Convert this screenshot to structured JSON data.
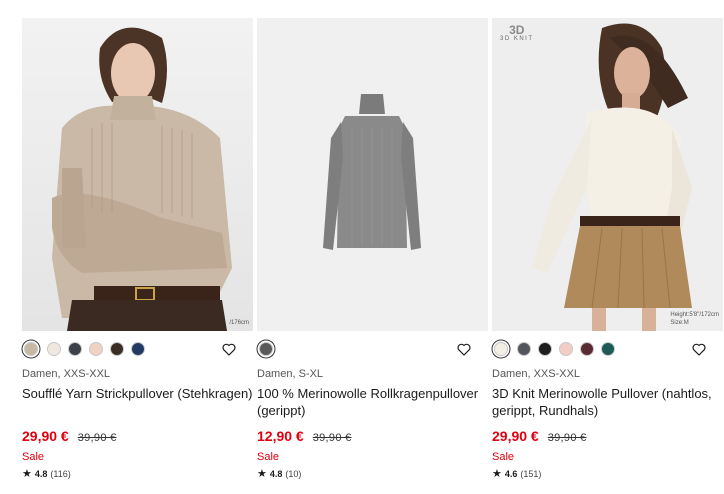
{
  "products": [
    {
      "image_alt": "Souffle Yarn sweater product image",
      "caption": "/176cm",
      "swatches": [
        "#c7b8a6",
        "#efe8e0",
        "#3c4047",
        "#f0d2c4",
        "#3a2d23",
        "#213a64"
      ],
      "selected_swatch": 0,
      "meta": "Damen, XXS-XXL",
      "name": "Soufflé Yarn Strickpullover (Stehkragen)",
      "price": "29,90 €",
      "old_price": "39,90 €",
      "sale": "Sale",
      "rating": "4.8",
      "reviews": "(116)"
    },
    {
      "image_alt": "Merino turtleneck product image",
      "caption": "",
      "swatches": [
        "#5a5a5a"
      ],
      "selected_swatch": 0,
      "meta": "Damen, S-XL",
      "name": "100 % Merinowolle Rollkragenpullover (gerippt)",
      "price": "12,90 €",
      "old_price": "39,90 €",
      "sale": "Sale",
      "rating": "4.8",
      "reviews": "(10)"
    },
    {
      "image_alt": "3D Knit merino sweater product image",
      "badge_mark": "3D",
      "badge_text": "3D KNIT",
      "caption_line1": "Height:5'8\"/172cm",
      "caption_line2": "Size:M",
      "swatches": [
        "#f4efe5",
        "#52565c",
        "#1e1e1e",
        "#f1cdc6",
        "#5a2a33",
        "#1d5a55"
      ],
      "selected_swatch": 0,
      "meta": "Damen, XXS-XXL",
      "name": "3D Knit Merinowolle Pullover (nahtlos, gerippt, Rundhals)",
      "price": "29,90 €",
      "old_price": "39,90 €",
      "sale": "Sale",
      "rating": "4.6",
      "reviews": "(151)"
    }
  ],
  "icons": {
    "favorite": "heart-outline-icon",
    "rating": "star-icon"
  }
}
